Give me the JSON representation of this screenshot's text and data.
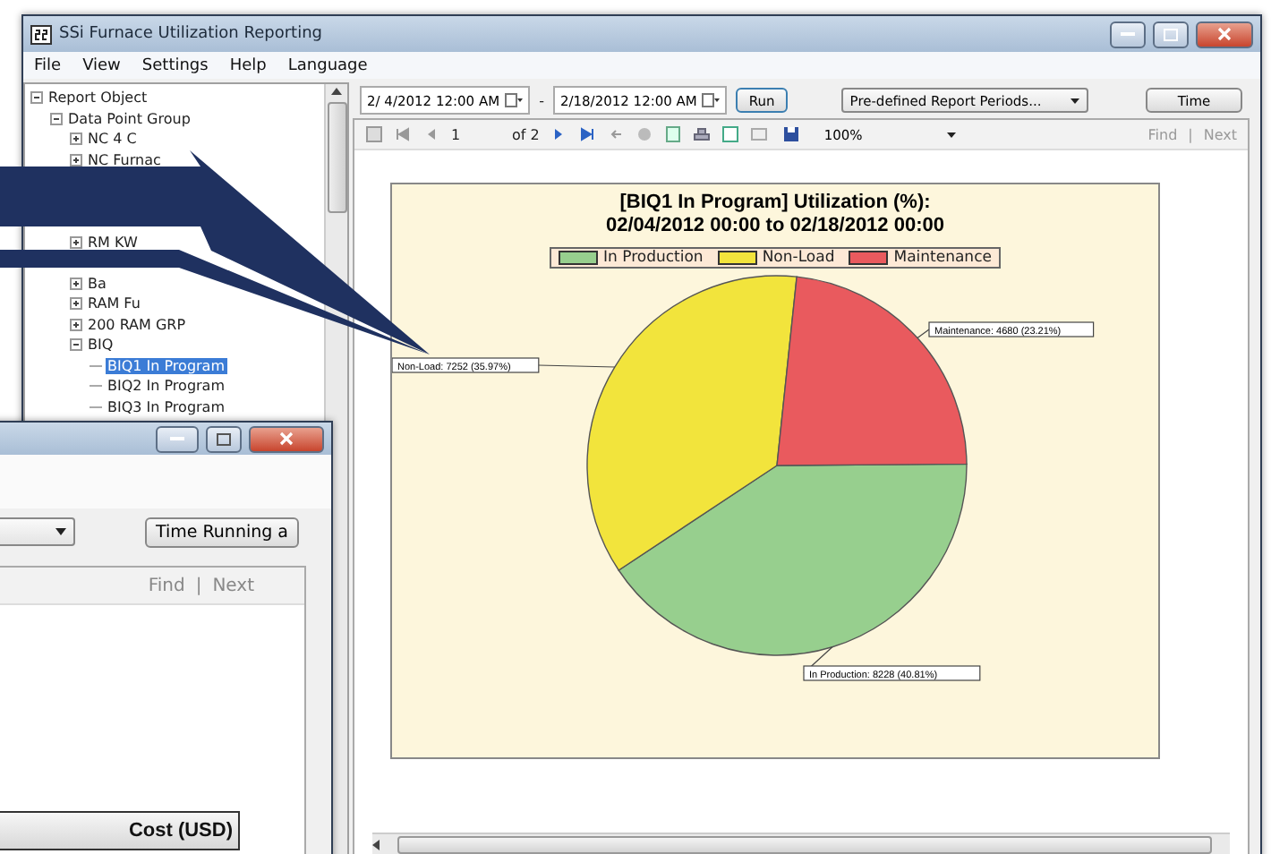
{
  "main_window": {
    "title": "SSi Furnace Utilization Reporting",
    "menu": [
      "File",
      "View",
      "Settings",
      "Help",
      "Language"
    ],
    "tree": [
      {
        "label": "Report Object",
        "expanded": true,
        "children": [
          {
            "label": "Data Point Group",
            "expanded": true,
            "children": [
              {
                "label": "NC 4 C",
                "expanded": false
              },
              {
                "label": "NC Furnac",
                "expanded": false
              },
              {
                "label": "RM KW",
                "expanded": false
              },
              {
                "label": "Ba",
                "expanded": false
              },
              {
                "label": "RAM Fu",
                "expanded": false
              },
              {
                "label": "200 RAM GRP",
                "expanded": false
              },
              {
                "label": "BIQ",
                "expanded": true,
                "children": [
                  {
                    "label": "BIQ1 In Program",
                    "selected": true
                  },
                  {
                    "label": "BIQ2 In Program",
                    "selected": false
                  },
                  {
                    "label": "BIQ3 In Program",
                    "selected": false
                  }
                ]
              }
            ]
          }
        ]
      }
    ],
    "start_date": "2/ 4/2012 12:00 AM",
    "separator": "-",
    "end_date": "2/18/2012 12:00 AM",
    "run_button": "Run",
    "period_dropdown": "Pre-defined Report Periods...",
    "time_button": "Time",
    "viewer": {
      "page": "1",
      "page_count": "of 2",
      "zoom": "100%",
      "find": "Find",
      "find_separator": "|",
      "next": "Next"
    },
    "chart_data": {
      "type": "pie",
      "title": "[BIQ1 In Program] Utilization (%):",
      "subtitle": "02/04/2012 00:00 to 02/18/2012 00:00",
      "categories": [
        "In Production",
        "Non-Load",
        "Maintenance"
      ],
      "values": [
        8228,
        7252,
        4680
      ],
      "colors": [
        "#97cf8e",
        "#f2e43c",
        "#e95a5e"
      ],
      "value_labels": [
        "In Production: 8228 (40.81%)",
        "Non-Load: 7252 (35.97%)",
        "Maintenance: 4680 (23.21%)"
      ]
    }
  },
  "second_window": {
    "time_button": "Time Running a",
    "find": "Find",
    "find_separator": "|",
    "next": "Next",
    "table_header": "Cost (USD)"
  }
}
